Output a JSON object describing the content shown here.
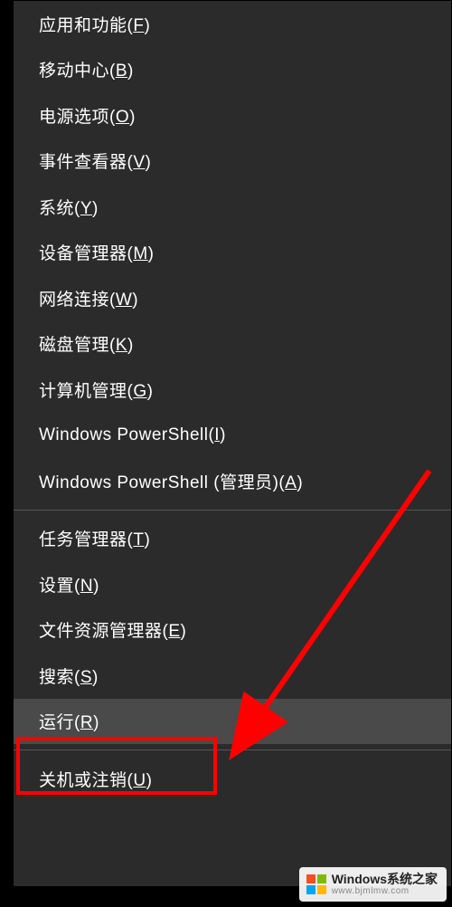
{
  "menu": {
    "groups": [
      [
        {
          "id": "apps-features",
          "label": "应用和功能(F)"
        },
        {
          "id": "mobility-center",
          "label": "移动中心(B)"
        },
        {
          "id": "power-options",
          "label": "电源选项(O)"
        },
        {
          "id": "event-viewer",
          "label": "事件查看器(V)"
        },
        {
          "id": "system",
          "label": "系统(Y)"
        },
        {
          "id": "device-manager",
          "label": "设备管理器(M)"
        },
        {
          "id": "network-connections",
          "label": "网络连接(W)"
        },
        {
          "id": "disk-management",
          "label": "磁盘管理(K)"
        },
        {
          "id": "computer-management",
          "label": "计算机管理(G)"
        },
        {
          "id": "powershell",
          "label": "Windows PowerShell(I)"
        },
        {
          "id": "powershell-admin",
          "label": "Windows PowerShell (管理员)(A)"
        }
      ],
      [
        {
          "id": "task-manager",
          "label": "任务管理器(T)"
        },
        {
          "id": "settings",
          "label": "设置(N)"
        },
        {
          "id": "file-explorer",
          "label": "文件资源管理器(E)"
        },
        {
          "id": "search",
          "label": "搜索(S)"
        },
        {
          "id": "run",
          "label": "运行(R)",
          "highlighted": true
        }
      ],
      [
        {
          "id": "shutdown-signout",
          "label": "关机或注销(U)"
        }
      ]
    ]
  },
  "annotation": {
    "highlight_target": "run",
    "arrow_color": "#ff0000"
  },
  "watermark": {
    "title": "Windows系统之家",
    "url": "www.bjmlmw.com"
  }
}
